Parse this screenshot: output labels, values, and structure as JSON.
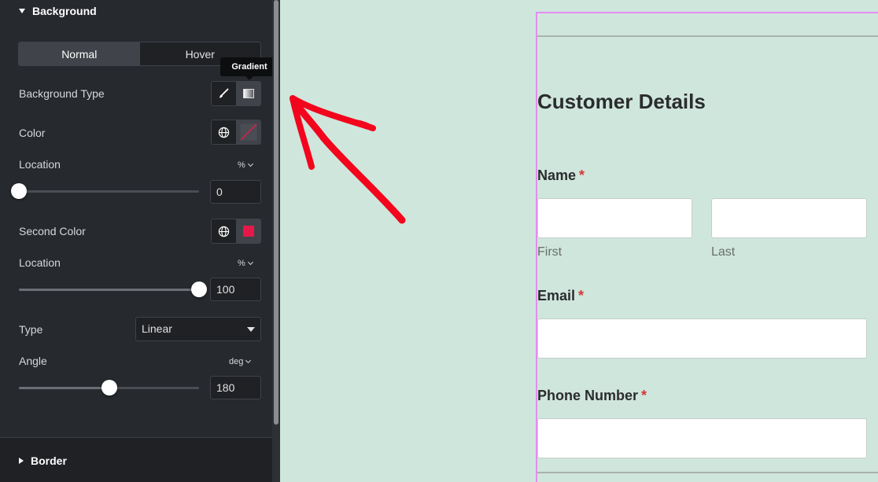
{
  "panel": {
    "section_title": "Background",
    "tabs": [
      {
        "label": "Normal",
        "active": true
      },
      {
        "label": "Hover",
        "active": false
      }
    ],
    "tooltip": "Gradient",
    "background_type": {
      "label": "Background Type",
      "options": [
        "classic-brush-icon",
        "gradient-icon"
      ],
      "active": "gradient"
    },
    "color": {
      "label": "Color",
      "swatch": "transparent"
    },
    "location1": {
      "label": "Location",
      "unit": "%",
      "value": "0",
      "fraction": 0
    },
    "second_color": {
      "label": "Second Color",
      "swatch": "#e8174a"
    },
    "location2": {
      "label": "Location",
      "unit": "%",
      "value": "100",
      "fraction": 1
    },
    "type": {
      "label": "Type",
      "value": "Linear"
    },
    "angle": {
      "label": "Angle",
      "unit": "deg",
      "value": "180",
      "fraction": 0.5
    },
    "border_section": "Border"
  },
  "form": {
    "title": "Customer Details",
    "name": {
      "label": "Name",
      "required": "*",
      "first": "First",
      "last": "Last"
    },
    "email": {
      "label": "Email",
      "required": "*"
    },
    "phone": {
      "label": "Phone Number",
      "required": "*"
    }
  },
  "colors": {
    "panel_bg": "#26292d",
    "canvas_bg": "#cfe6dc",
    "annotation_arrow": "#f2051d",
    "selection_outline": "#e48df0",
    "required": "#d63638"
  }
}
